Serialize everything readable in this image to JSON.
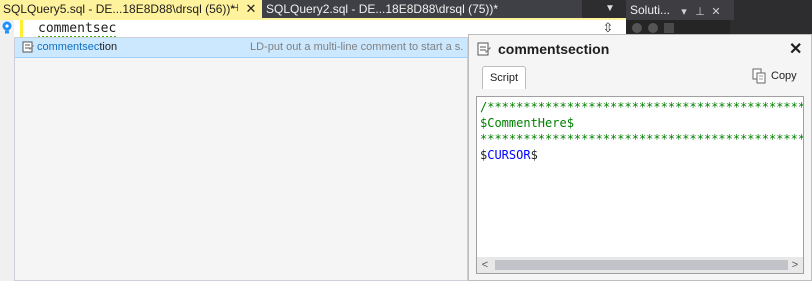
{
  "tabs": {
    "active": {
      "title": "SQLQuery5.sql - DE...18E8D88\\drsql (56))*",
      "pin_glyph": "⊣",
      "close_glyph": "✕"
    },
    "inactive": {
      "title": "SQLQuery2.sql - DE...18E8D88\\drsql (75))*"
    },
    "dropdown_glyph": "▼"
  },
  "solution_panel": {
    "title": "Soluti...",
    "icons": [
      "dropdown-icon",
      "pin-icon",
      "close-icon"
    ],
    "icon_glyphs": [
      "▾",
      "⊥",
      "✕"
    ]
  },
  "editor": {
    "typed_text": "commentsec",
    "split_glyph": "⇳"
  },
  "completion": {
    "item": {
      "name_match": "commentsec",
      "name_rest": "tion",
      "description": "LD-put out a multi-line comment to start a s..."
    }
  },
  "popup": {
    "title": "commentsection",
    "close_glyph": "✕",
    "tab_label": "Script",
    "copy_label": "Copy",
    "code_lines": [
      "/**************************************************",
      "$CommentHere$",
      "**************************************************",
      "$CURSOR$"
    ],
    "scroll_left": "<",
    "scroll_right": ">"
  },
  "colors": {
    "tab_active_bg": "#fff29d",
    "selection_bg": "#cce8ff",
    "comment_green": "#008000",
    "keyword_blue": "#0000ff"
  }
}
